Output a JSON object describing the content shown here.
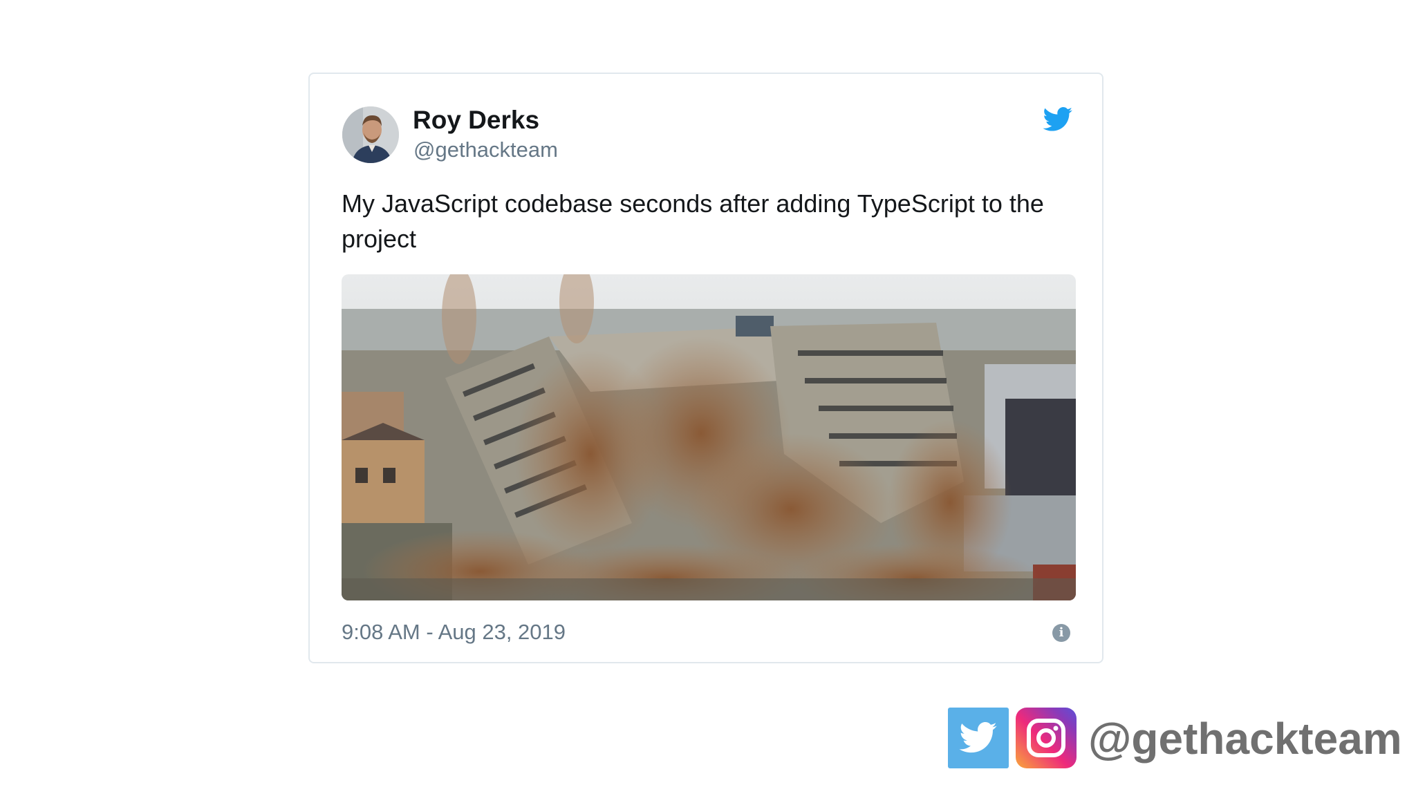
{
  "tweet": {
    "display_name": "Roy Derks",
    "handle": "@gethackteam",
    "text": "My JavaScript codebase seconds after adding TypeScript to the project",
    "timestamp": "9:08 AM - Aug 23, 2019",
    "icons": {
      "brand": "twitter-bird-icon",
      "info": "info-icon"
    }
  },
  "footer": {
    "handle": "@gethackteam",
    "icons": [
      "twitter-icon",
      "instagram-icon"
    ]
  },
  "colors": {
    "twitter_blue": "#1da1f2",
    "text": "#14171a",
    "muted": "#657786"
  }
}
